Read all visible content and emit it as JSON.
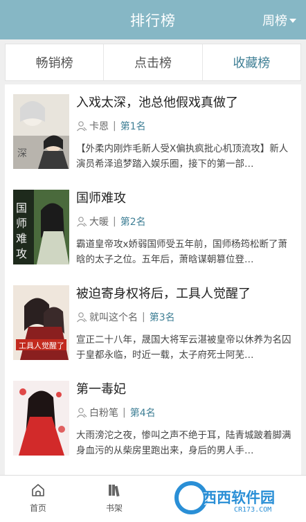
{
  "header": {
    "title": "排行榜",
    "period_label": "周榜"
  },
  "tabs": [
    {
      "label": "畅销榜",
      "active": false
    },
    {
      "label": "点击榜",
      "active": false
    },
    {
      "label": "收藏榜",
      "active": true
    }
  ],
  "books": [
    {
      "title": "入戏太深，池总他假戏真做了",
      "author": "卡恩",
      "rank": "第1名",
      "desc": "【外柔内刚炸毛新人受X偏执疯批心机顶流攻】新人演员希泽追梦踏入娱乐圈，接下的第一部…"
    },
    {
      "title": "国师难攻",
      "author": "大暖",
      "rank": "第2名",
      "desc": "霸道皇帝攻x娇弱国师受五年前，国师杨筠松断了萧晗的太子之位。五年后，萧晗谋朝篡位登…"
    },
    {
      "title": "被迫寄身权将后，工具人觉醒了",
      "author": "就叫这个名",
      "rank": "第3名",
      "desc": "宣正二十八年，晟国大将军云湛被皇帝以休养为名囚于皇都永临，时近一载，太子府死士阿芜…"
    },
    {
      "title": "第一毒妃",
      "author": "白粉笔",
      "rank": "第4名",
      "desc": "大雨滂沱之夜，惨叫之声不绝于耳，陆青城跛着脚满身血污的从柴房里跑出来，身后的男人手…"
    }
  ],
  "bottom_nav": [
    {
      "label": "首页"
    },
    {
      "label": "书架"
    }
  ],
  "watermark": {
    "text": "西西软件园",
    "url": "CR173.COM"
  },
  "colors": {
    "header": "#86b7c5",
    "accent": "#3f7f95"
  }
}
